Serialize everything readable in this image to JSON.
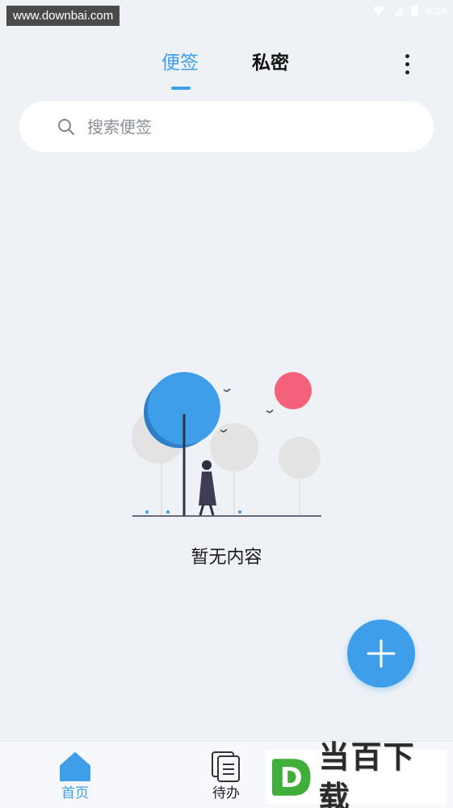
{
  "status_bar": {
    "watermark": "www.downbai.com",
    "time": "4:34",
    "icons": [
      "wifi-icon",
      "signal-icon",
      "battery-icon"
    ]
  },
  "header": {
    "tabs": [
      {
        "label": "便签",
        "selected": true
      },
      {
        "label": "私密",
        "selected": false
      }
    ],
    "more_icon": "more-vertical-icon"
  },
  "search": {
    "placeholder": "搜索便签",
    "icon": "search-icon"
  },
  "empty_state": {
    "text": "暂无内容"
  },
  "fab": {
    "icon": "plus-icon"
  },
  "bottom_nav": {
    "items": [
      {
        "label": "首页",
        "icon": "home-icon",
        "selected": true
      },
      {
        "label": "待办",
        "icon": "todo-icon",
        "selected": false
      }
    ]
  },
  "ad_banner": {
    "text": "当百下载",
    "logo_letter": "D"
  },
  "colors": {
    "accent": "#3e9ee9",
    "background": "#eef2f7",
    "sun": "#f3627a",
    "tree_gray": "#e3e3e3"
  }
}
